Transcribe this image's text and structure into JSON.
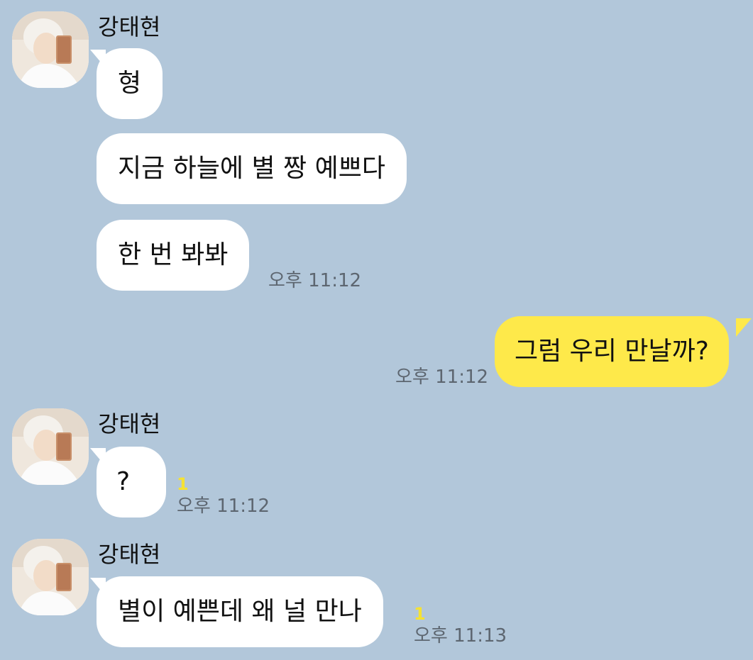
{
  "sender_name": "강태현",
  "messages": [
    {
      "text": "형"
    },
    {
      "text": "지금 하늘에 별 짱 예쁘다"
    },
    {
      "text": "한 번 봐봐",
      "time": "오후 11:12"
    },
    {
      "text": "그럼 우리 만날까?",
      "time": "오후 11:12"
    },
    {
      "text": "?",
      "unread": "1",
      "time": "오후 11:12"
    },
    {
      "text": "별이 예쁜데 왜 널 만나",
      "unread": "1",
      "time": "오후 11:13"
    }
  ],
  "colors": {
    "background": "#b2c7da",
    "incoming_bubble": "#ffffff",
    "outgoing_bubble": "#fee94a",
    "unread_count": "#f5e233",
    "timestamp": "#5d6670"
  },
  "icons": {
    "avatar": "profile-photo-avatar"
  }
}
